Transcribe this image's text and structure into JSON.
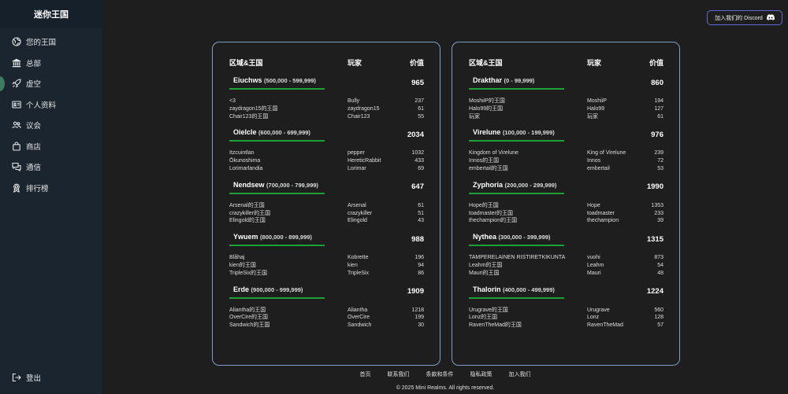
{
  "brand": "迷你王国",
  "nav": [
    {
      "label": "您的王国",
      "icon": "globe-icon"
    },
    {
      "label": "总部",
      "icon": "bank-icon"
    },
    {
      "label": "虚空",
      "icon": "rocket-icon"
    },
    {
      "label": "个人资料",
      "icon": "id-card-icon"
    },
    {
      "label": "议会",
      "icon": "people-icon"
    },
    {
      "label": "商店",
      "icon": "shopping-bag-icon"
    },
    {
      "label": "通信",
      "icon": "chat-icon"
    },
    {
      "label": "排行榜",
      "icon": "award-icon"
    }
  ],
  "logout": {
    "label": "登出",
    "icon": "logout-icon"
  },
  "discord_button": "加入我们的 Discord",
  "table_headers": {
    "region": "区域&王国",
    "player": "玩家",
    "value": "价值"
  },
  "left_regions": [
    {
      "name": "Eiuchws",
      "range": "(500,000 - 599,999)",
      "total": "965",
      "rows": [
        [
          "<3",
          "Bully",
          "237"
        ],
        [
          "zaydragon15的王国",
          "zaydragon15",
          "61"
        ],
        [
          "Chair123的王国",
          "Chair123",
          "55"
        ]
      ]
    },
    {
      "name": "Oielcle",
      "range": "(600,000 - 699,999)",
      "total": "2034",
      "rows": [
        [
          "Itzcuintlan",
          "pepper",
          "1032"
        ],
        [
          "Ōkunoshima",
          "HereticRabbit",
          "433"
        ],
        [
          "Lorimarlandia",
          "Lorimar",
          "69"
        ]
      ]
    },
    {
      "name": "Nendsew",
      "range": "(700,000 - 799,999)",
      "total": "647",
      "rows": [
        [
          "Arsenal的王国",
          "Arsenal",
          "61"
        ],
        [
          "crazykiller的王国",
          "crazykiller",
          "51"
        ],
        [
          "Elingold的王国",
          "Elingold",
          "43"
        ]
      ]
    },
    {
      "name": "Ywuem",
      "range": "(800,000 - 899,999)",
      "total": "988",
      "rows": [
        [
          "Blåhaj",
          "Kobrette",
          "196"
        ],
        [
          "kien的王国",
          "kien",
          "94"
        ],
        [
          "TripleSix的王国",
          "TripleSix",
          "86"
        ]
      ]
    },
    {
      "name": "Erde",
      "range": "(900,000 - 999,999)",
      "total": "1909",
      "rows": [
        [
          "Aliantha的王国",
          "Aliantha",
          "1218"
        ],
        [
          "OverCire的王国",
          "OverCire",
          "199"
        ],
        [
          "Sandwich的王国",
          "Sandwich",
          "30"
        ]
      ]
    }
  ],
  "right_regions": [
    {
      "name": "Drakthar",
      "range": "(0 - 99,999)",
      "total": "860",
      "rows": [
        [
          "MoshiiP的王国",
          "MoshiiP",
          "194"
        ],
        [
          "Halo99的王国",
          "Halo99",
          "127"
        ],
        [
          "玩家",
          "玩家",
          "61"
        ]
      ]
    },
    {
      "name": "Virelune",
      "range": "(100,000 - 199,999)",
      "total": "976",
      "rows": [
        [
          "Kingdom of Virelune",
          "King of Virelune",
          "239"
        ],
        [
          "Innos的王国",
          "Innos",
          "72"
        ],
        [
          "embertail的王国",
          "embertail",
          "53"
        ]
      ]
    },
    {
      "name": "Zyphoria",
      "range": "(200,000 - 299,999)",
      "total": "1990",
      "rows": [
        [
          "Hope的王国",
          "Hope",
          "1353"
        ],
        [
          "toadmaster的王国",
          "toadmaster",
          "233"
        ],
        [
          "thechampion的王国",
          "thechampion",
          "39"
        ]
      ]
    },
    {
      "name": "Nythea",
      "range": "(300,000 - 399,999)",
      "total": "1315",
      "rows": [
        [
          "TAMPERELAINEN RISTIRETKIKUNTA",
          "vuohi",
          "873"
        ],
        [
          "Leahm的王国",
          "Leahm",
          "54"
        ],
        [
          "Mauri的王国",
          "Mauri",
          "48"
        ]
      ]
    },
    {
      "name": "Thalorin",
      "range": "(400,000 - 499,999)",
      "total": "1224",
      "rows": [
        [
          "Urugrave的王国",
          "Urugrave",
          "560"
        ],
        [
          "Lonz的王国",
          "Lonz",
          "128"
        ],
        [
          "RavenTheMad的王国",
          "RavenTheMad",
          "57"
        ]
      ]
    }
  ],
  "footer": {
    "links": [
      "首页",
      "联系我们",
      "条款和条件",
      "隐私政策",
      "加入我们"
    ],
    "copyright": "© 2025 Mini Realms. All rights reserved."
  }
}
